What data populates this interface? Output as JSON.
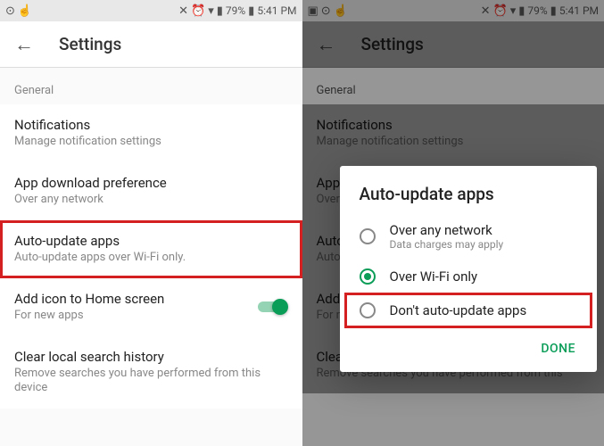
{
  "status": {
    "battery": "79%",
    "time": "5:41 PM"
  },
  "header": {
    "title": "Settings"
  },
  "section": "General",
  "items": {
    "notifications": {
      "title": "Notifications",
      "sub": "Manage notification settings"
    },
    "download": {
      "title": "App download preference",
      "sub": "Over any network"
    },
    "autoupdate": {
      "title": "Auto-update apps",
      "sub": "Auto-update apps over Wi-Fi only."
    },
    "addicon": {
      "title": "Add icon to Home screen",
      "sub": "For new apps"
    },
    "clear": {
      "title": "Clear local search history",
      "sub": "Remove searches you have performed from this device"
    }
  },
  "dialog": {
    "title": "Auto-update apps",
    "opt1": {
      "label": "Over any network",
      "sub": "Data charges may apply"
    },
    "opt2": {
      "label": "Over Wi-Fi only"
    },
    "opt3": {
      "label": "Don't auto-update apps"
    },
    "done": "DONE"
  },
  "right_truncated": {
    "download_title": "App do",
    "download_sub": "Over a",
    "autoupdate_title": "Auto-u",
    "autoupdate_sub": "Auto-u",
    "addicon_title": "Add i",
    "addicon_sub": "For ne",
    "clear_title": "Clear",
    "clear_sub": "Remove searches you have performed from this"
  }
}
